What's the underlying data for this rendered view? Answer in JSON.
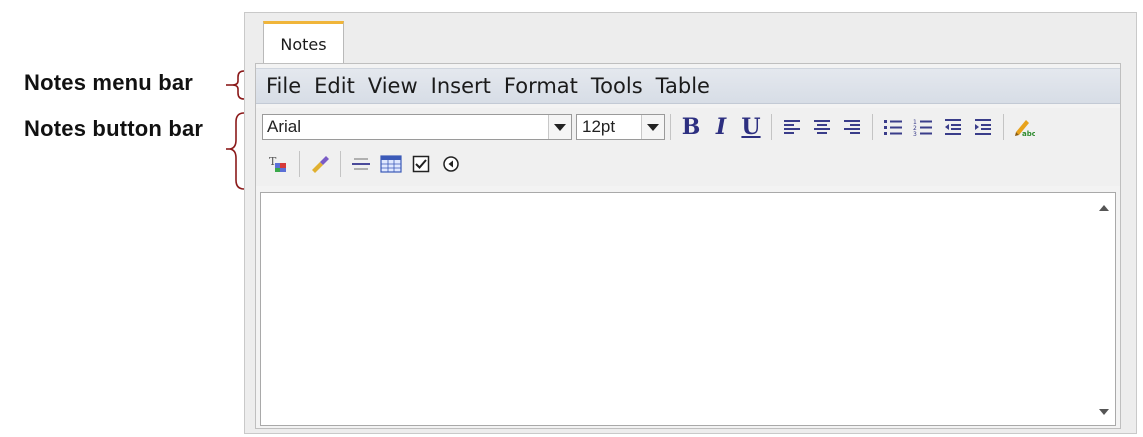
{
  "annotations": {
    "menu_bar": "Notes menu bar",
    "button_bar": "Notes button bar"
  },
  "tab": {
    "label": "Notes"
  },
  "menu": {
    "items": [
      "File",
      "Edit",
      "View",
      "Insert",
      "Format",
      "Tools",
      "Table"
    ]
  },
  "toolbar": {
    "font": "Arial",
    "size": "12pt",
    "bold": "B",
    "italic": "I",
    "underline": "U",
    "icons_row1": [
      "align-left-icon",
      "align-center-icon",
      "align-right-icon",
      "bulleted-list-icon",
      "numbered-list-icon",
      "outdent-icon",
      "indent-icon",
      "spell-check-icon"
    ],
    "icons_row2": [
      "clear-formatting-icon",
      "format-painter-icon",
      "horizontal-rule-icon",
      "insert-table-icon",
      "checkbox-icon",
      "radio-button-icon"
    ]
  },
  "colors": {
    "tab_accent": "#f0b53a",
    "menubar_bg": "#dde2ea",
    "toolbar_icon": "#2d2f80"
  }
}
